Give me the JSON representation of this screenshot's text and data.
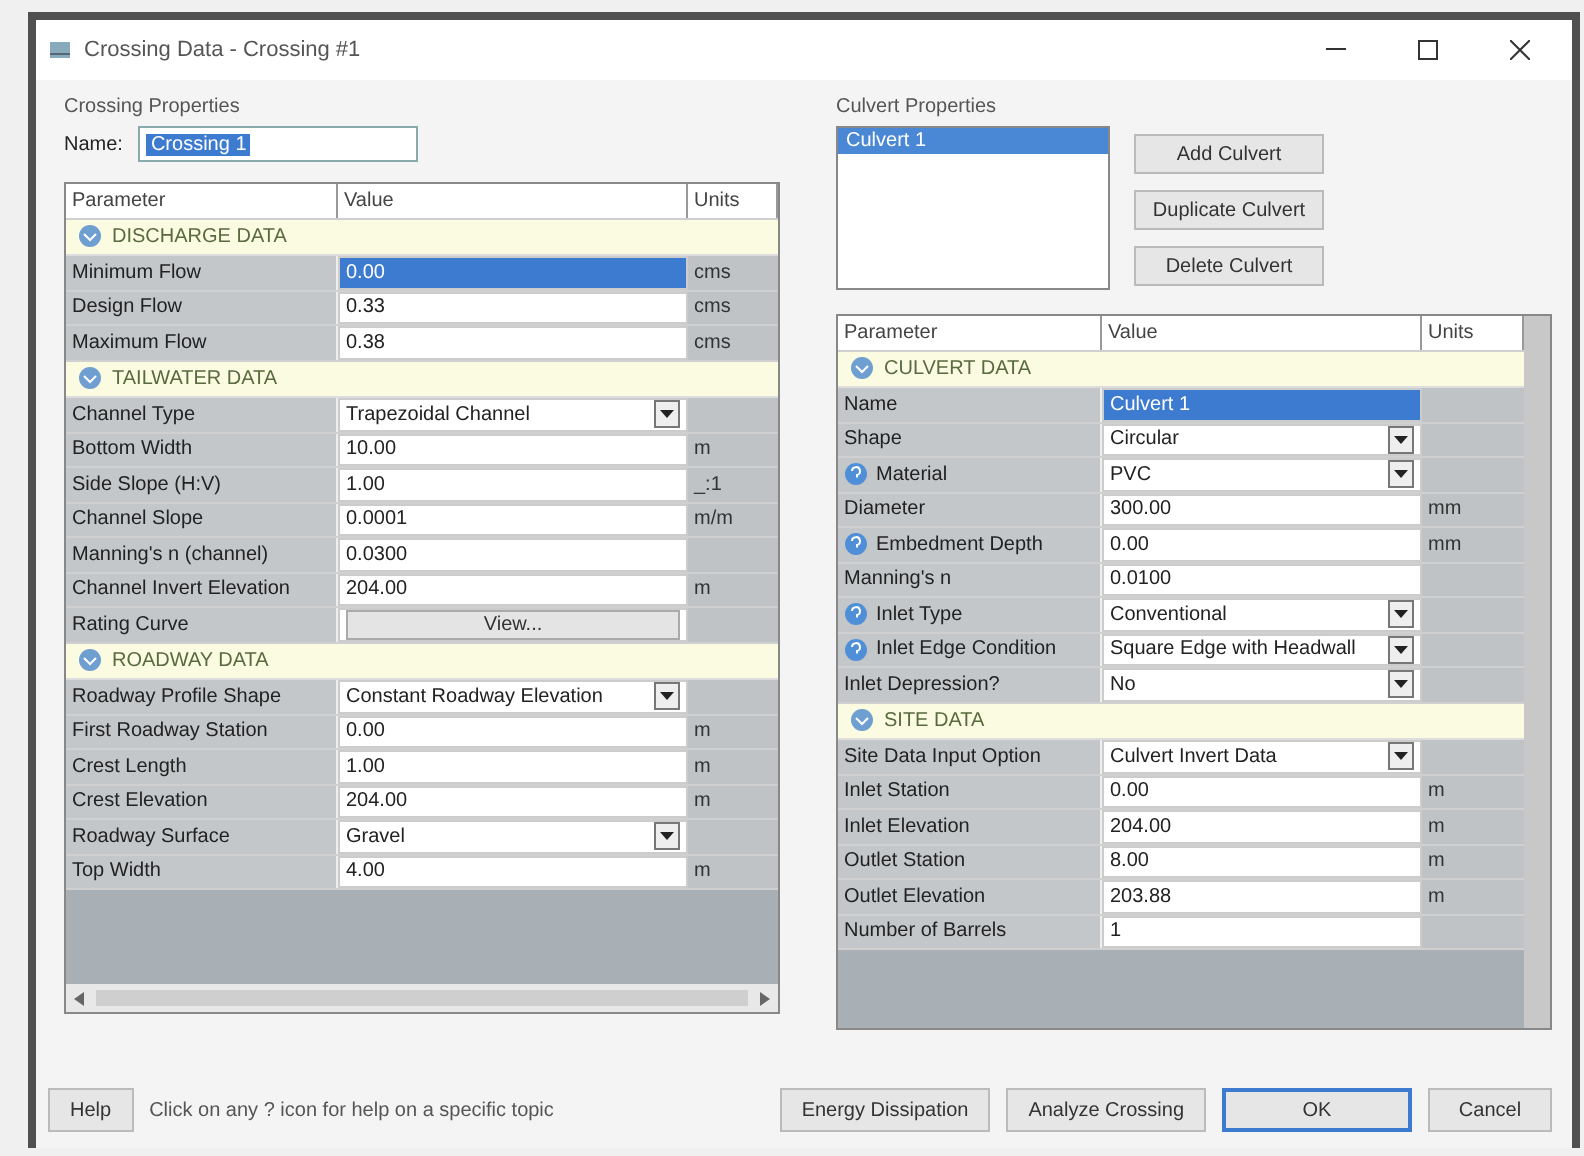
{
  "window": {
    "title": "Crossing Data - Crossing #1"
  },
  "crossing_properties": {
    "heading": "Crossing Properties",
    "name_label": "Name:",
    "name_value": "Crossing 1",
    "columns": [
      "Parameter",
      "Value",
      "Units"
    ],
    "rows": [
      {
        "kind": "section",
        "label": "DISCHARGE DATA"
      },
      {
        "kind": "text",
        "label": "Minimum Flow",
        "value": "0.00",
        "unit": "cms",
        "selected": true,
        "help": false
      },
      {
        "kind": "text",
        "label": "Design Flow",
        "value": "0.33",
        "unit": "cms",
        "selected": false,
        "help": false
      },
      {
        "kind": "text",
        "label": "Maximum Flow",
        "value": "0.38",
        "unit": "cms",
        "selected": false,
        "help": false
      },
      {
        "kind": "section",
        "label": "TAILWATER DATA"
      },
      {
        "kind": "dropdown",
        "label": "Channel Type",
        "value": "Trapezoidal Channel",
        "selected": false,
        "help": false
      },
      {
        "kind": "text",
        "label": "Bottom Width",
        "value": "10.00",
        "unit": "m",
        "selected": false,
        "help": false
      },
      {
        "kind": "text",
        "label": "Side Slope (H:V)",
        "value": "1.00",
        "unit": "_:1",
        "selected": false,
        "help": false
      },
      {
        "kind": "text",
        "label": "Channel Slope",
        "value": "0.0001",
        "unit": "m/m",
        "selected": false,
        "help": false
      },
      {
        "kind": "text",
        "label": "Manning's n (channel)",
        "value": "0.0300",
        "selected": false,
        "help": false
      },
      {
        "kind": "text",
        "label": "Channel Invert Elevation",
        "value": "204.00",
        "unit": "m",
        "selected": false,
        "help": false
      },
      {
        "kind": "button",
        "label": "Rating Curve",
        "value": "View...",
        "selected": false,
        "help": false
      },
      {
        "kind": "section",
        "label": "ROADWAY DATA"
      },
      {
        "kind": "dropdown",
        "label": "Roadway Profile Shape",
        "value": "Constant Roadway Elevation",
        "selected": false,
        "help": false
      },
      {
        "kind": "text",
        "label": "First Roadway Station",
        "value": "0.00",
        "unit": "m",
        "selected": false,
        "help": false
      },
      {
        "kind": "text",
        "label": "Crest Length",
        "value": "1.00",
        "unit": "m",
        "selected": false,
        "help": false
      },
      {
        "kind": "text",
        "label": "Crest Elevation",
        "value": "204.00",
        "unit": "m",
        "selected": false,
        "help": false
      },
      {
        "kind": "dropdown",
        "label": "Roadway Surface",
        "value": "Gravel",
        "selected": false,
        "help": false
      },
      {
        "kind": "text",
        "label": "Top Width",
        "value": "4.00",
        "unit": "m",
        "selected": false,
        "help": false
      }
    ]
  },
  "culvert_properties": {
    "heading": "Culvert Properties",
    "culverts": [
      {
        "label": "Culvert 1",
        "selected": true
      }
    ],
    "buttons": [
      "Add Culvert",
      "Duplicate Culvert",
      "Delete Culvert"
    ],
    "columns": [
      "Parameter",
      "Value",
      "Units"
    ],
    "rows": [
      {
        "kind": "section",
        "label": "CULVERT DATA"
      },
      {
        "kind": "text",
        "label": "Name",
        "value": "Culvert 1",
        "selected": true,
        "help": false
      },
      {
        "kind": "dropdown",
        "label": "Shape",
        "value": "Circular",
        "selected": false,
        "help": false
      },
      {
        "kind": "dropdown",
        "label": "Material",
        "value": "PVC",
        "selected": false,
        "help": true
      },
      {
        "kind": "text",
        "label": "Diameter",
        "value": "300.00",
        "unit": "mm",
        "selected": false,
        "help": false
      },
      {
        "kind": "text",
        "label": "Embedment Depth",
        "value": "0.00",
        "unit": "mm",
        "selected": false,
        "help": true
      },
      {
        "kind": "text",
        "label": "Manning's n",
        "value": "0.0100",
        "selected": false,
        "help": false
      },
      {
        "kind": "dropdown",
        "label": "Inlet Type",
        "value": "Conventional",
        "selected": false,
        "help": true
      },
      {
        "kind": "dropdown",
        "label": "Inlet Edge Condition",
        "value": "Square Edge with Headwall",
        "selected": false,
        "help": true
      },
      {
        "kind": "dropdown",
        "label": "Inlet Depression?",
        "value": "No",
        "selected": false,
        "help": false
      },
      {
        "kind": "section",
        "label": "SITE DATA"
      },
      {
        "kind": "dropdown",
        "label": "Site Data Input Option",
        "value": "Culvert Invert Data",
        "selected": false,
        "help": false
      },
      {
        "kind": "text",
        "label": "Inlet Station",
        "value": "0.00",
        "unit": "m",
        "selected": false,
        "help": false
      },
      {
        "kind": "text",
        "label": "Inlet Elevation",
        "value": "204.00",
        "unit": "m",
        "selected": false,
        "help": false
      },
      {
        "kind": "text",
        "label": "Outlet Station",
        "value": "8.00",
        "unit": "m",
        "selected": false,
        "help": false
      },
      {
        "kind": "text",
        "label": "Outlet Elevation",
        "value": "203.88",
        "unit": "m",
        "selected": false,
        "help": false
      },
      {
        "kind": "text",
        "label": "Number of Barrels",
        "value": "1",
        "selected": false,
        "help": false
      }
    ]
  },
  "footer": {
    "help_button": "Help",
    "hint": "Click on any ? icon for help on a specific topic",
    "buttons": [
      "Energy Dissipation",
      "Analyze Crossing",
      "OK",
      "Cancel"
    ]
  }
}
